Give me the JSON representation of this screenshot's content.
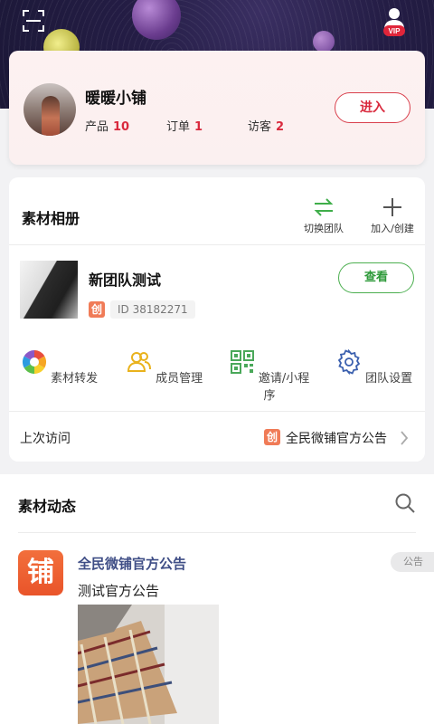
{
  "header": {
    "scan_icon": "scan-icon",
    "vip_label": "VIP"
  },
  "profile": {
    "shop_name": "暖暖小铺",
    "stats": [
      {
        "label": "产品",
        "value": "10"
      },
      {
        "label": "订单",
        "value": "1"
      },
      {
        "label": "访客",
        "value": "2"
      }
    ],
    "enter_label": "进入"
  },
  "album": {
    "title": "素材相册",
    "tools": [
      {
        "label": "切换团队",
        "icon": "switch-arrows-icon"
      },
      {
        "label": "加入/创建",
        "icon": "plus-icon"
      }
    ],
    "team": {
      "name": "新团队测试",
      "badge": "创",
      "id_text": "ID 38182271",
      "view_label": "查看"
    },
    "functions": [
      {
        "label": "素材转发",
        "icon": "aperture-icon"
      },
      {
        "label": "成员管理",
        "icon": "members-icon"
      },
      {
        "label": "邀请/小程序",
        "icon": "qr-code-icon"
      },
      {
        "label": "团队设置",
        "icon": "gear-icon"
      }
    ],
    "last_visit": {
      "label": "上次访问",
      "badge": "创",
      "value": "全民微铺官方公告"
    }
  },
  "feed": {
    "title": "素材动态",
    "post": {
      "logo_char": "铺",
      "author": "全民微铺官方公告",
      "text": "测试官方公告",
      "tag": "公告"
    }
  },
  "colors": {
    "accent_red": "#d9293d",
    "accent_green": "#2e9a3a",
    "author_blue": "#3f4e86",
    "badge_orange": "#f07b57"
  }
}
